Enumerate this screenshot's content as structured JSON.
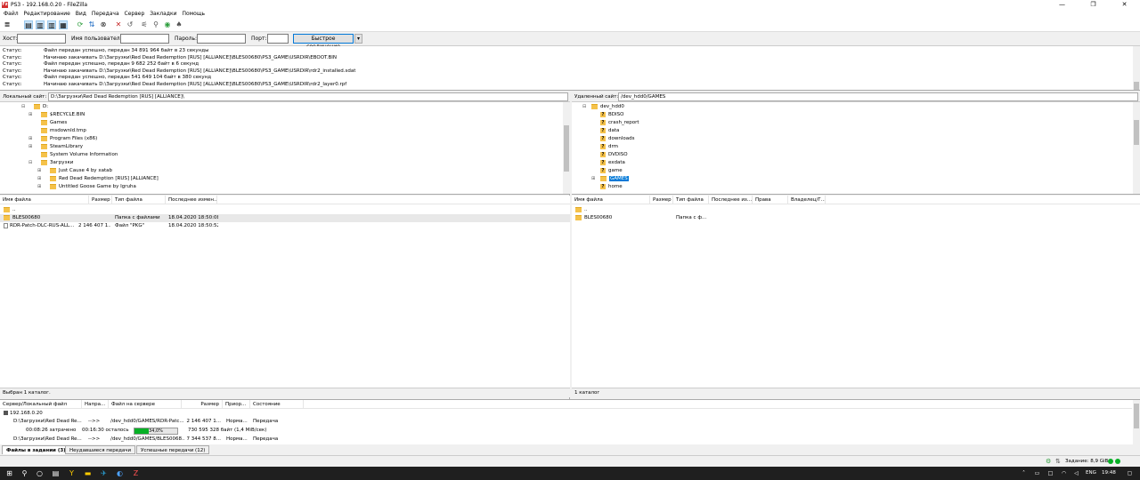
{
  "window": {
    "title": "PS3 - 192.168.0.20 - FileZilla",
    "logo": "Fz",
    "minimize": "—",
    "maximize": "❐",
    "close": "✕"
  },
  "menu": [
    "Файл",
    "Редактирование",
    "Вид",
    "Передача",
    "Сервер",
    "Закладки",
    "Помощь"
  ],
  "quickconnect": {
    "host_label": "Хост:",
    "user_label": "Имя пользователя:",
    "pass_label": "Пароль:",
    "port_label": "Порт:",
    "connect_label": "Быстрое соединение",
    "dropdown": "▾"
  },
  "log": [
    {
      "label": "Статус:",
      "text": "Файл передан успешно, передан 34 891 964 байт в 23 секунды"
    },
    {
      "label": "Статус:",
      "text": "Начинаю закачивать D:\\Загрузки\\Red Dead Redemption [RUS] [ALLIANCE]\\BLES00680\\PS3_GAME\\USRDIR\\EBOOT.BIN"
    },
    {
      "label": "Статус:",
      "text": "Файл передан успешно, передан 9 682 252 байт в 6 секунд"
    },
    {
      "label": "Статус:",
      "text": "Начинаю закачивать D:\\Загрузки\\Red Dead Redemption [RUS] [ALLIANCE]\\BLES00680\\PS3_GAME\\USRDIR\\rdr2_installed.sdat"
    },
    {
      "label": "Статус:",
      "text": "Файл передан успешно, передан 541 649 104 байт в 380 секунд"
    },
    {
      "label": "Статус:",
      "text": "Начинаю закачивать D:\\Загрузки\\Red Dead Redemption [RUS] [ALLIANCE]\\BLES00680\\PS3_GAME\\USRDIR\\rdr2_layer0.rpf"
    }
  ],
  "local": {
    "site_label": "Локальный сайт:",
    "path": "D:\\Загрузки\\Red Dead Redemption [RUS] [ALLIANCE]\\",
    "tree": [
      {
        "name": "D:",
        "exp": "⊟"
      },
      {
        "name": "$RECYCLE.BIN",
        "exp": "⊞"
      },
      {
        "name": "Games",
        "exp": ""
      },
      {
        "name": "msdownld.tmp",
        "exp": ""
      },
      {
        "name": "Program Files (x86)",
        "exp": "⊞"
      },
      {
        "name": "SteamLibrary",
        "exp": "⊞"
      },
      {
        "name": "System Volume Information",
        "exp": ""
      },
      {
        "name": "Загрузки",
        "exp": "⊟"
      },
      {
        "name": "Just Cause 4 by xatab",
        "exp": "⊞"
      },
      {
        "name": "Red Dead Redemption [RUS] [ALLIANCE]",
        "exp": "⊞"
      },
      {
        "name": "Untitled Goose Game by Igruha",
        "exp": "⊞"
      }
    ],
    "headers": [
      "Имя файла",
      "Размер",
      "Тип файла",
      "Последнее измен..."
    ],
    "files": [
      {
        "name": "..",
        "size": "",
        "type": "",
        "date": ""
      },
      {
        "name": "BLES00680",
        "size": "",
        "type": "Папка с файлами",
        "date": "18.04.2020 18:50:08"
      },
      {
        "name": "RDR-Patch-DLC-RUS-ALL...",
        "size": "2 146 407 1...",
        "type": "Файл \"PKG\"",
        "date": "18.04.2020 18:50:52"
      }
    ],
    "status": "Выбран 1 каталог."
  },
  "remote": {
    "site_label": "Удаленный сайт:",
    "path": "/dev_hdd0/GAMES",
    "tree": [
      {
        "name": "dev_hdd0",
        "unknown": false,
        "exp": "⊟"
      },
      {
        "name": "BDISO",
        "unknown": true,
        "exp": ""
      },
      {
        "name": "crash_report",
        "unknown": true,
        "exp": ""
      },
      {
        "name": "data",
        "unknown": true,
        "exp": ""
      },
      {
        "name": "downloads",
        "unknown": true,
        "exp": ""
      },
      {
        "name": "drm",
        "unknown": true,
        "exp": ""
      },
      {
        "name": "DVDISO",
        "unknown": true,
        "exp": ""
      },
      {
        "name": "exdata",
        "unknown": true,
        "exp": ""
      },
      {
        "name": "game",
        "unknown": true,
        "exp": ""
      },
      {
        "name": "GAMES",
        "unknown": false,
        "exp": "⊞",
        "selected": true
      },
      {
        "name": "home",
        "unknown": true,
        "exp": ""
      }
    ],
    "headers": [
      "Имя файла",
      "Размер",
      "Тип файла",
      "Последнее из...",
      "Права",
      "Владелец/Г..."
    ],
    "files": [
      {
        "name": "..",
        "type": ""
      },
      {
        "name": "BLES00680",
        "type": "Папка с ф..."
      }
    ],
    "status": "1 каталог"
  },
  "queue": {
    "headers": [
      "Сервер/Локальный файл",
      "Напра...",
      "Файл на сервере",
      "Размер",
      "Приор...",
      "Состояние"
    ],
    "server": "192.168.0.20",
    "rows": [
      {
        "local": "D:\\Загрузки\\Red Dead Re...",
        "dir": "-->>",
        "remote": "/dev_hdd0/GAMES/RDR-Patc...",
        "size": "2 146 407 1...",
        "prio": "Норма...",
        "state": "Передача"
      },
      {
        "local": "D:\\Загрузки\\Red Dead Re...",
        "dir": "-->>",
        "remote": "/dev_hdd0/GAMES/BLES0068...",
        "size": "7 344 537 8...",
        "prio": "Норма...",
        "state": "Передача"
      }
    ],
    "progress": {
      "elapsed": "00:08:26 затрачено",
      "left": "00:16:30 осталось",
      "percent_text": "34,0%",
      "fraction": 0.34,
      "bytes": "730 595 328 байт (1,4 MiB/сек)"
    }
  },
  "queue_tabs": [
    "Файлы в задании (3)",
    "Неудавшиеся передачи",
    "Успешные передачи (12)"
  ],
  "statusbar": {
    "queue": "Задание: 8,9 GiB"
  },
  "taskbar": {
    "lang": "ENG",
    "time": "19:48"
  },
  "colors": {
    "progress": "#06b025",
    "selection": "#0078d7",
    "folder": "#f5c24a"
  }
}
